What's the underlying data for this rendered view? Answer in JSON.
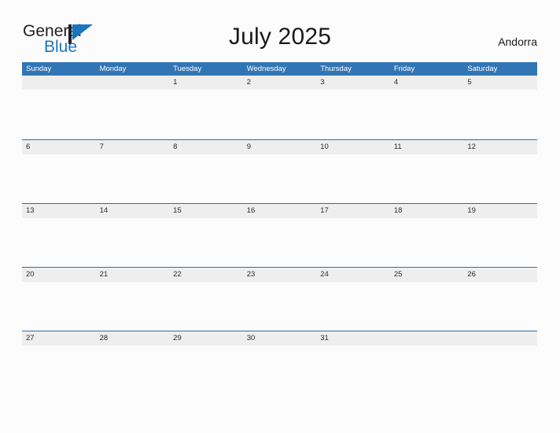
{
  "brand": {
    "name_part1": "General",
    "name_part2": "Blue",
    "flag_icon": "flag-triangle-icon",
    "color_dark": "#231f20",
    "color_blue": "#1b75bb"
  },
  "header": {
    "title": "July 2025",
    "locale": "Andorra"
  },
  "calendar": {
    "accent_header_color": "#3275b4",
    "rule_color": "#2e6da4",
    "band_color": "#eeeeee",
    "weekdays": [
      "Sunday",
      "Monday",
      "Tuesday",
      "Wednesday",
      "Thursday",
      "Friday",
      "Saturday"
    ],
    "weeks": [
      [
        "",
        "",
        "1",
        "2",
        "3",
        "4",
        "5"
      ],
      [
        "6",
        "7",
        "8",
        "9",
        "10",
        "11",
        "12"
      ],
      [
        "13",
        "14",
        "15",
        "16",
        "17",
        "18",
        "19"
      ],
      [
        "20",
        "21",
        "22",
        "23",
        "24",
        "25",
        "26"
      ],
      [
        "27",
        "28",
        "29",
        "30",
        "31",
        "",
        ""
      ]
    ]
  }
}
